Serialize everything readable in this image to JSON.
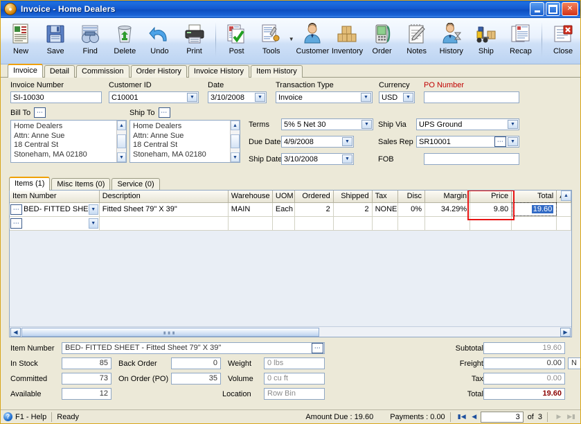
{
  "window": {
    "title": "Invoice - Home Dealers",
    "icon": "invoice-app-icon",
    "minimize_label": "Minimize",
    "maximize_label": "Maximize",
    "close_label": "Close"
  },
  "toolbar": {
    "groups": [
      [
        {
          "label": "New",
          "icon": "new-document-icon"
        },
        {
          "label": "Save",
          "icon": "floppy-disk-icon"
        },
        {
          "label": "Find",
          "icon": "binoculars-icon"
        },
        {
          "label": "Delete",
          "icon": "trash-can-icon"
        },
        {
          "label": "Undo",
          "icon": "undo-arrow-icon"
        },
        {
          "label": "Print",
          "icon": "printer-icon"
        }
      ],
      [
        {
          "label": "Post",
          "icon": "post-checkmark-icon"
        },
        {
          "label": "Tools",
          "icon": "tools-wrench-icon",
          "has_dropdown": true
        },
        {
          "label": "Customer",
          "icon": "customer-person-icon"
        },
        {
          "label": "Inventory",
          "icon": "inventory-boxes-icon"
        },
        {
          "label": "Order",
          "icon": "order-device-icon"
        },
        {
          "label": "Notes",
          "icon": "notepad-pen-icon"
        },
        {
          "label": "History",
          "icon": "history-person-hourglass-icon"
        },
        {
          "label": "Ship",
          "icon": "forklift-ship-icon"
        },
        {
          "label": "Recap",
          "icon": "recap-report-icon"
        }
      ],
      [
        {
          "label": "Close",
          "icon": "close-document-icon"
        }
      ]
    ]
  },
  "main_tabs": [
    {
      "label": "Invoice",
      "active": true
    },
    {
      "label": "Detail",
      "active": false
    },
    {
      "label": "Commission",
      "active": false
    },
    {
      "label": "Order History",
      "active": false
    },
    {
      "label": "Invoice History",
      "active": false
    },
    {
      "label": "Item History",
      "active": false
    }
  ],
  "header_form": {
    "invoice_number": {
      "label": "Invoice Number",
      "value": "SI-10030"
    },
    "customer_id": {
      "label": "Customer ID",
      "value": "C10001"
    },
    "date": {
      "label": "Date",
      "value": "3/10/2008"
    },
    "transaction_type": {
      "label": "Transaction Type",
      "value": "Invoice"
    },
    "currency": {
      "label": "Currency",
      "value": "USD"
    },
    "po_number": {
      "label": "PO Number",
      "value": ""
    },
    "bill_to": {
      "label": "Bill To",
      "lines": [
        "Home Dealers",
        "Attn: Anne Sue",
        "18 Central St",
        "Stoneham, MA 02180"
      ]
    },
    "ship_to": {
      "label": "Ship To",
      "lines": [
        "Home Dealers",
        "Attn: Anne Sue",
        "18 Central St",
        "Stoneham, MA 02180"
      ]
    },
    "terms": {
      "label": "Terms",
      "value": "5% 5 Net 30"
    },
    "due_date": {
      "label": "Due Date",
      "value": "4/9/2008"
    },
    "ship_date": {
      "label": "Ship Date",
      "value": "3/10/2008"
    },
    "ship_via": {
      "label": "Ship Via",
      "value": "UPS Ground"
    },
    "sales_rep": {
      "label": "Sales Rep",
      "value": "SR10001"
    },
    "fob": {
      "label": "FOB",
      "value": ""
    }
  },
  "items_tabs": [
    {
      "label": "Items (1)",
      "active": true
    },
    {
      "label": "Misc Items (0)",
      "active": false
    },
    {
      "label": "Service (0)",
      "active": false
    }
  ],
  "grid": {
    "columns": [
      "Item Number",
      "Description",
      "Warehouse",
      "UOM",
      "Ordered",
      "Shipped",
      "Tax",
      "Disc",
      "Margin",
      "Price",
      "Total",
      "A"
    ],
    "rows": [
      {
        "item_number": "BED- FITTED SHEE",
        "description": "Fitted Sheet 79\" X 39\"",
        "warehouse": "MAIN",
        "uom": "Each",
        "ordered": "2",
        "shipped": "2",
        "tax": "NONE",
        "disc": "0%",
        "margin": "34.29%",
        "price": "9.80",
        "total": "19.60",
        "total_selected": true
      },
      {
        "item_number": "",
        "description": "",
        "warehouse": "",
        "uom": "",
        "ordered": "",
        "shipped": "",
        "tax": "",
        "disc": "",
        "margin": "",
        "price": "",
        "total": "",
        "total_selected": false
      }
    ],
    "highlight_color": "#e81313",
    "highlighted_column": "Price"
  },
  "item_detail": {
    "item_number": {
      "label": "Item Number",
      "value": "BED- FITTED SHEET - Fitted Sheet 79\" X 39\""
    },
    "in_stock": {
      "label": "In Stock",
      "value": "85"
    },
    "committed": {
      "label": "Committed",
      "value": "73"
    },
    "available": {
      "label": "Available",
      "value": "12"
    },
    "back_order": {
      "label": "Back Order",
      "value": "0"
    },
    "on_order_po": {
      "label": "On Order (PO)",
      "value": "35"
    },
    "weight": {
      "label": "Weight",
      "value": "0 lbs"
    },
    "volume": {
      "label": "Volume",
      "value": "0 cu ft"
    },
    "location": {
      "label": "Location",
      "value": "Row  Bin"
    }
  },
  "totals": {
    "subtotal": {
      "label": "Subtotal",
      "value": "19.60"
    },
    "freight": {
      "label": "Freight",
      "value": "0.00",
      "taxable_flag": "N"
    },
    "tax": {
      "label": "Tax",
      "value": "0.00"
    },
    "total": {
      "label": "Total",
      "value": "19.60",
      "color": "#8b0000"
    }
  },
  "statusbar": {
    "help": "F1 - Help",
    "state": "Ready",
    "amount_due": "Amount Due : 19.60",
    "payments": "Payments : 0.00",
    "record_current": "3",
    "record_of": "of",
    "record_total": "3"
  }
}
